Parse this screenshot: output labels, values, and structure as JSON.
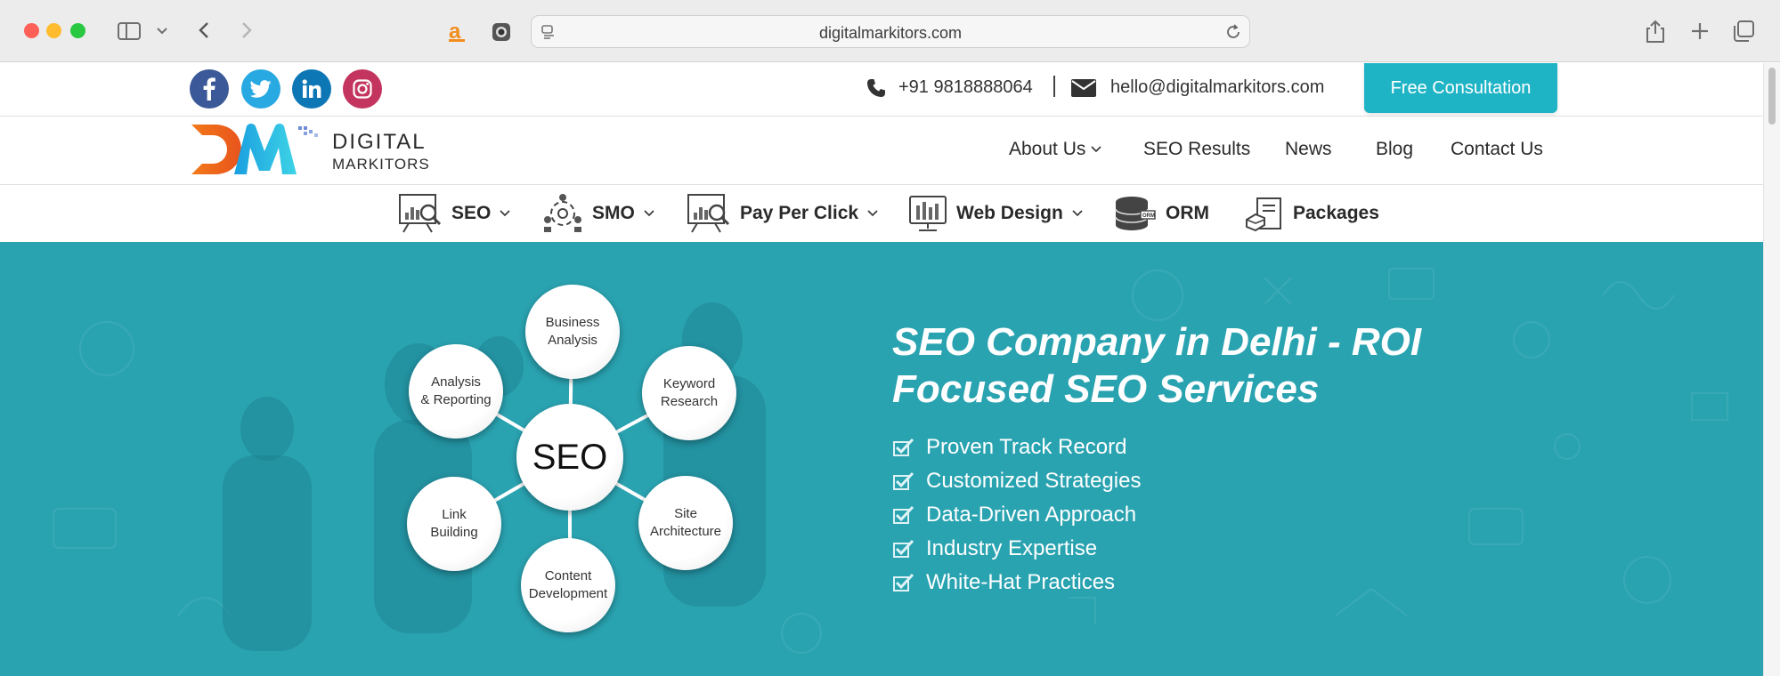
{
  "browser": {
    "url": "digitalmarkitors.com"
  },
  "topbar": {
    "social": [
      "facebook-icon",
      "twitter-icon",
      "linkedin-icon",
      "instagram-icon"
    ],
    "phone": "+91 9818888064",
    "email": "hello@digitalmarkitors.com",
    "cta_label": "Free Consultation"
  },
  "logo": {
    "line1": "DIGITAL",
    "line2": "MARKITORS"
  },
  "nav": {
    "items": [
      {
        "label": "About Us"
      },
      {
        "label": "SEO Results"
      },
      {
        "label": "News"
      },
      {
        "label": "Blog"
      },
      {
        "label": "Contact Us"
      }
    ]
  },
  "services": {
    "items": [
      {
        "label": "SEO",
        "icon": "seo-analytics-icon"
      },
      {
        "label": "SMO",
        "icon": "social-network-icon"
      },
      {
        "label": "Pay Per Click",
        "icon": "ppc-analytics-icon"
      },
      {
        "label": "Web Design",
        "icon": "web-design-icon"
      },
      {
        "label": "ORM",
        "icon": "orm-database-icon"
      },
      {
        "label": "Packages",
        "icon": "packages-icon"
      }
    ]
  },
  "hero": {
    "title": "SEO Company in Delhi - ROI Focused SEO Services",
    "bullets": [
      "Proven Track Record",
      "Customized Strategies",
      "Data-Driven Approach",
      "Industry Expertise",
      "White-Hat Practices"
    ],
    "wheel": {
      "center": "SEO",
      "nodes": [
        {
          "l1": "Business",
          "l2": "Analysis"
        },
        {
          "l1": "Keyword",
          "l2": "Research"
        },
        {
          "l1": "Site",
          "l2": "Architecture"
        },
        {
          "l1": "Content",
          "l2": "Development"
        },
        {
          "l1": "Link",
          "l2": "Building"
        },
        {
          "l1": "Analysis",
          "l2": "& Reporting"
        }
      ]
    }
  },
  "colors": {
    "accent": "#1fb4c5",
    "hero_bg": "#2aa3b1",
    "facebook": "#3b5998",
    "twitter": "#29a9e1",
    "linkedin": "#0d77b5",
    "instagram": "#c3355f"
  }
}
